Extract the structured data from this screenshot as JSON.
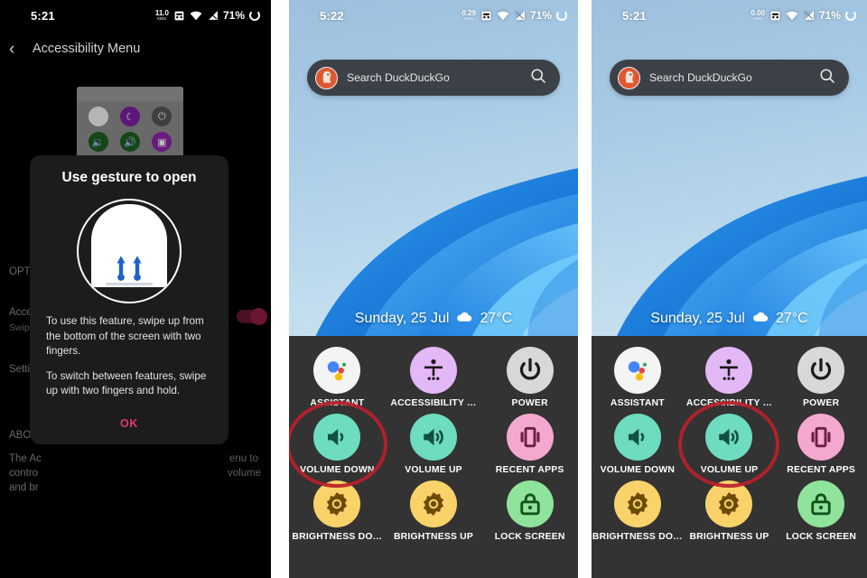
{
  "panels": [
    {
      "id": "accessibility-settings",
      "status": {
        "time": "5:21",
        "net_rate": "11.0",
        "net_unit": "KB/S",
        "battery": "71%"
      },
      "appbar": {
        "back_icon": "chevron-left-icon",
        "title": "Accessibility Menu"
      },
      "preview": {
        "alt": "accessibility-menu-preview",
        "dots": [
          {
            "name": "assistant",
            "color": "#f2f2f2",
            "glyph": ""
          },
          {
            "name": "accessibility",
            "color": "#7b1fa2",
            "glyph": "♁"
          },
          {
            "name": "power",
            "color": "#555555",
            "glyph": "⏻"
          },
          {
            "name": "volume-down",
            "color": "#1b5e20",
            "glyph": "🔉"
          },
          {
            "name": "volume-up",
            "color": "#1b5e20",
            "glyph": "🔊"
          },
          {
            "name": "recent-apps",
            "color": "#8e24aa",
            "glyph": "▣"
          }
        ]
      },
      "background_text": {
        "options_header": "OPTIO",
        "setting_row_title": "Acces",
        "setting_row_sub": "Swipe",
        "settings_label": "Settin",
        "about_header": "ABOUT",
        "about_line1": "The Ac",
        "about_line2": "contro",
        "about_line3": "and br",
        "about_right1": "enu to",
        "about_right2": "volume"
      },
      "toggle": {
        "name": "accessibility-menu-toggle",
        "state": "on"
      },
      "dialog": {
        "title": "Use gesture to open",
        "illustration": "two-finger-swipe-up-icon",
        "paragraph1": "To use this feature, swipe up from the bottom of the screen with two fingers.",
        "paragraph2": "To switch between features, swipe up with two fingers and hold.",
        "ok_label": "OK",
        "ok_color": "#e23a6e"
      }
    },
    {
      "id": "home-volume-down-highlighted",
      "status": {
        "time": "5:22",
        "net_rate": "0.29",
        "net_unit": "KB/S",
        "battery": "71%"
      },
      "search": {
        "placeholder": "Search DuckDuckGo",
        "logo": "duckduckgo-logo",
        "mag_icon": "search-icon"
      },
      "weather": {
        "date": "Sunday, 25 Jul",
        "icon": "cloud-icon",
        "temperature": "27°C"
      },
      "highlight": "VOLUME DOWN"
    },
    {
      "id": "home-volume-up-highlighted",
      "status": {
        "time": "5:21",
        "net_rate": "0.00",
        "net_unit": "KB/S",
        "battery": "71%"
      },
      "search": {
        "placeholder": "Search DuckDuckGo",
        "logo": "duckduckgo-logo",
        "mag_icon": "search-icon"
      },
      "weather": {
        "date": "Sunday, 25 Jul",
        "icon": "cloud-icon",
        "temperature": "27°C"
      },
      "highlight": "VOLUME UP"
    }
  ],
  "accessibility_menu": {
    "items": [
      {
        "label": "ASSISTANT",
        "icon": "assistant-icon",
        "color": "#f4f4f4"
      },
      {
        "label": "ACCESSIBILITY …",
        "icon": "accessibility-icon",
        "color": "#e3b8f7"
      },
      {
        "label": "POWER",
        "icon": "power-icon",
        "color": "#d8d8d8"
      },
      {
        "label": "VOLUME DOWN",
        "icon": "volume-down-icon",
        "color": "#6ddcc0"
      },
      {
        "label": "VOLUME UP",
        "icon": "volume-up-icon",
        "color": "#6ddcc0"
      },
      {
        "label": "RECENT APPS",
        "icon": "recent-apps-icon",
        "color": "#f5a8cf"
      },
      {
        "label": "BRIGHTNESS DO…",
        "icon": "brightness-down-icon",
        "color": "#fad26a"
      },
      {
        "label": "BRIGHTNESS UP",
        "icon": "brightness-up-icon",
        "color": "#fad26a"
      },
      {
        "label": "LOCK SCREEN",
        "icon": "lock-icon",
        "color": "#8fe39b"
      }
    ]
  },
  "colors": {
    "highlight_ring": "#b9202a",
    "tray_background": "#333333",
    "dialog_background": "#1c1c1c",
    "accent_pink": "#e23a6e"
  }
}
